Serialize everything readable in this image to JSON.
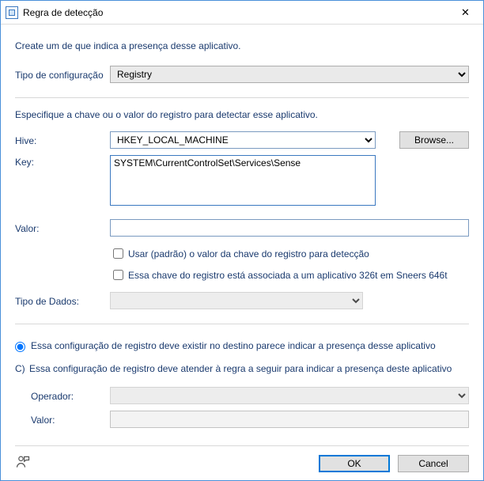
{
  "window": {
    "title": "Regra de detecção"
  },
  "intro": "Create um de que indica a presença desse aplicativo.",
  "config_type": {
    "label": "Tipo de configuração",
    "value": "Registry"
  },
  "instr2": "Especifique a chave ou o valor do registro para detectar esse aplicativo.",
  "hive": {
    "label": "Hive:",
    "value": "HKEY_LOCAL_MACHINE",
    "browse": "Browse..."
  },
  "key": {
    "label": "Key:",
    "value": "SYSTEM\\CurrentControlSet\\Services\\Sense"
  },
  "valor": {
    "label": "Valor:",
    "value": ""
  },
  "chk1": {
    "label": "Usar (padrão) o valor da chave do registro para detecção",
    "checked": false
  },
  "chk2": {
    "label": "Essa chave do registro está associada a um aplicativo 326t em Sneers 646t",
    "checked": false
  },
  "datatype": {
    "label": "Tipo de Dados:",
    "value": ""
  },
  "radio1": {
    "label": "Essa configuração de registro deve existir no destino parece indicar a presença desse aplicativo",
    "selected": true
  },
  "radio2": {
    "prefix": "C)",
    "label": "Essa configuração de registro deve atender à regra a seguir para indicar a presença deste aplicativo",
    "selected": false
  },
  "operator": {
    "label": "Operador:",
    "value": ""
  },
  "valor2": {
    "label": "Valor:",
    "value": ""
  },
  "buttons": {
    "ok": "OK",
    "cancel": "Cancel"
  }
}
